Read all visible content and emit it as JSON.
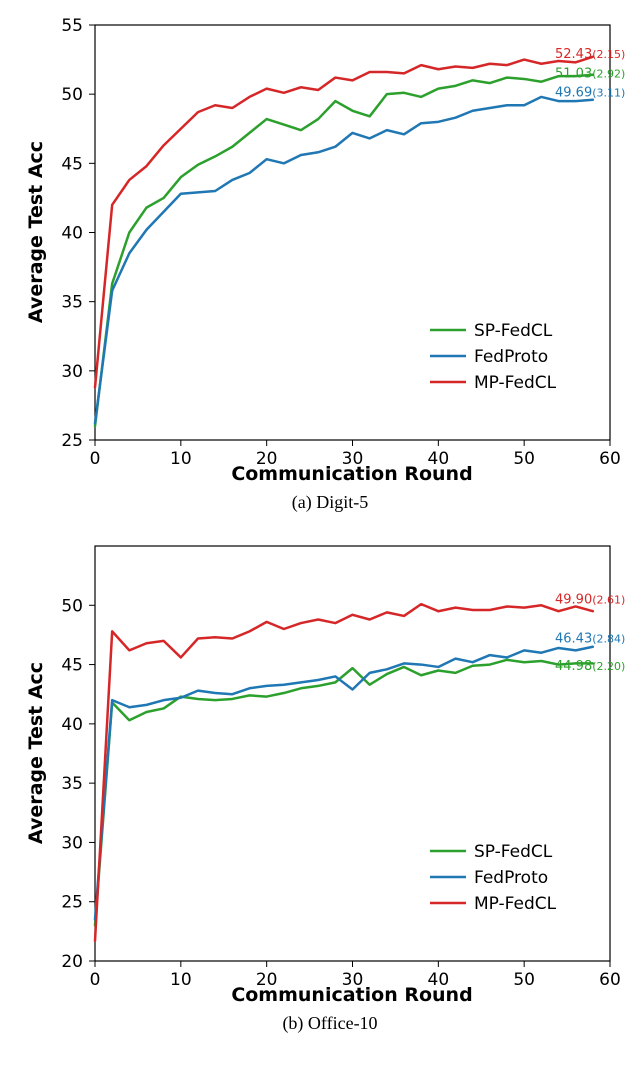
{
  "chart_data": [
    {
      "type": "line",
      "id": "digit5",
      "caption": "(a)  Digit-5",
      "xlabel": "Communication Round",
      "ylabel": "Average Test Acc",
      "xlim": [
        0,
        60
      ],
      "ylim": [
        25,
        55
      ],
      "xticks": [
        0,
        10,
        20,
        30,
        40,
        50,
        60
      ],
      "yticks": [
        25,
        30,
        35,
        40,
        45,
        50,
        55
      ],
      "x": [
        0,
        2,
        4,
        6,
        8,
        10,
        12,
        14,
        16,
        18,
        20,
        22,
        24,
        26,
        28,
        30,
        32,
        34,
        36,
        38,
        40,
        42,
        44,
        46,
        48,
        50,
        52,
        54,
        56,
        58
      ],
      "series": [
        {
          "name": "SP-FedCL",
          "color": "#2ca02c",
          "end_label": "51.03",
          "end_paren": "(2.92)",
          "end_y": 51.0,
          "values": [
            26.0,
            36.3,
            40.0,
            41.8,
            42.5,
            44.0,
            44.9,
            45.5,
            46.2,
            47.2,
            48.2,
            47.8,
            47.4,
            48.2,
            49.5,
            48.8,
            48.4,
            50.0,
            50.1,
            49.8,
            50.4,
            50.6,
            51.0,
            50.8,
            51.2,
            51.1,
            50.9,
            51.3,
            51.3,
            51.4
          ]
        },
        {
          "name": "FedProto",
          "color": "#1f77b4",
          "end_label": "49.69",
          "end_paren": "(3.11)",
          "end_y": 49.6,
          "values": [
            26.2,
            35.8,
            38.5,
            40.2,
            41.5,
            42.8,
            42.9,
            43.0,
            43.8,
            44.3,
            45.3,
            45.0,
            45.6,
            45.8,
            46.2,
            47.2,
            46.8,
            47.4,
            47.1,
            47.9,
            48.0,
            48.3,
            48.8,
            49.0,
            49.2,
            49.2,
            49.8,
            49.5,
            49.5,
            49.6
          ]
        },
        {
          "name": "MP-FedCL",
          "color": "#d62728",
          "end_label": "52.43",
          "end_paren": "(2.15)",
          "end_y": 52.4,
          "values": [
            28.8,
            42.0,
            43.8,
            44.8,
            46.3,
            47.5,
            48.7,
            49.2,
            49.0,
            49.8,
            50.4,
            50.1,
            50.5,
            50.3,
            51.2,
            51.0,
            51.6,
            51.6,
            51.5,
            52.1,
            51.8,
            52.0,
            51.9,
            52.2,
            52.1,
            52.5,
            52.2,
            52.4,
            52.3,
            52.7
          ]
        }
      ],
      "legend": [
        "SP-FedCL",
        "FedProto",
        "MP-FedCL"
      ],
      "legend_colors": [
        "#2ca02c",
        "#1f77b4",
        "#d62728"
      ]
    },
    {
      "type": "line",
      "id": "office10",
      "caption": "(b)  Office-10",
      "xlabel": "Communication Round",
      "ylabel": "Average Test Acc",
      "xlim": [
        0,
        60
      ],
      "ylim": [
        20,
        55
      ],
      "xticks": [
        0,
        10,
        20,
        30,
        40,
        50,
        60
      ],
      "yticks": [
        20,
        25,
        30,
        35,
        40,
        45,
        50
      ],
      "x": [
        0,
        2,
        4,
        6,
        8,
        10,
        12,
        14,
        16,
        18,
        20,
        22,
        24,
        26,
        28,
        30,
        32,
        34,
        36,
        38,
        40,
        42,
        44,
        46,
        48,
        50,
        52,
        54,
        56,
        58
      ],
      "series": [
        {
          "name": "SP-FedCL",
          "color": "#2ca02c",
          "end_label": "44.98",
          "end_paren": "(2.20)",
          "end_y": 44.3,
          "values": [
            23.0,
            41.8,
            40.3,
            41.0,
            41.3,
            42.3,
            42.1,
            42.0,
            42.1,
            42.4,
            42.3,
            42.6,
            43.0,
            43.2,
            43.5,
            44.7,
            43.3,
            44.2,
            44.8,
            44.1,
            44.5,
            44.3,
            44.9,
            45.0,
            45.4,
            45.2,
            45.3,
            45.0,
            45.1,
            45.1
          ]
        },
        {
          "name": "FedProto",
          "color": "#1f77b4",
          "end_label": "46.43",
          "end_paren": "(2.84)",
          "end_y": 46.6,
          "values": [
            23.5,
            42.0,
            41.4,
            41.6,
            42.0,
            42.2,
            42.8,
            42.6,
            42.5,
            43.0,
            43.2,
            43.3,
            43.5,
            43.7,
            44.0,
            42.9,
            44.3,
            44.6,
            45.1,
            45.0,
            44.8,
            45.5,
            45.2,
            45.8,
            45.6,
            46.2,
            46.0,
            46.4,
            46.2,
            46.5
          ]
        },
        {
          "name": "MP-FedCL",
          "color": "#d62728",
          "end_label": "49.90",
          "end_paren": "(2.61)",
          "end_y": 49.9,
          "values": [
            21.7,
            47.8,
            46.2,
            46.8,
            47.0,
            45.6,
            47.2,
            47.3,
            47.2,
            47.8,
            48.6,
            48.0,
            48.5,
            48.8,
            48.5,
            49.2,
            48.8,
            49.4,
            49.1,
            50.1,
            49.5,
            49.8,
            49.6,
            49.6,
            49.9,
            49.8,
            50.0,
            49.5,
            49.9,
            49.5
          ]
        }
      ],
      "legend": [
        "SP-FedCL",
        "FedProto",
        "MP-FedCL"
      ],
      "legend_colors": [
        "#2ca02c",
        "#1f77b4",
        "#d62728"
      ]
    }
  ]
}
